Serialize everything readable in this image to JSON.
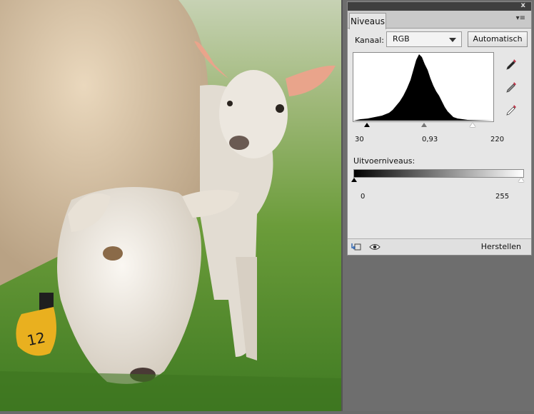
{
  "panel": {
    "tab_label": "Niveaus",
    "close_glyph": "x",
    "menu_glyph": "▾≡"
  },
  "channel": {
    "label": "Kanaal:",
    "selected": "RGB",
    "auto_label": "Automatisch"
  },
  "input_levels": {
    "black": "30",
    "gamma": "0,93",
    "white": "220"
  },
  "output": {
    "label": "Uitvoerniveaus:",
    "black": "0",
    "white": "255"
  },
  "footer": {
    "reset_label": "Herstellen"
  },
  "icons": {
    "eyedroppers": [
      "black-eyedropper-icon",
      "gray-eyedropper-icon",
      "white-eyedropper-icon"
    ],
    "footer": [
      "clip-to-layer-icon",
      "visibility-eye-icon"
    ]
  },
  "colors": {
    "panel_bg": "#e6e6e6",
    "eyedropper_accent": "#c0364a"
  }
}
